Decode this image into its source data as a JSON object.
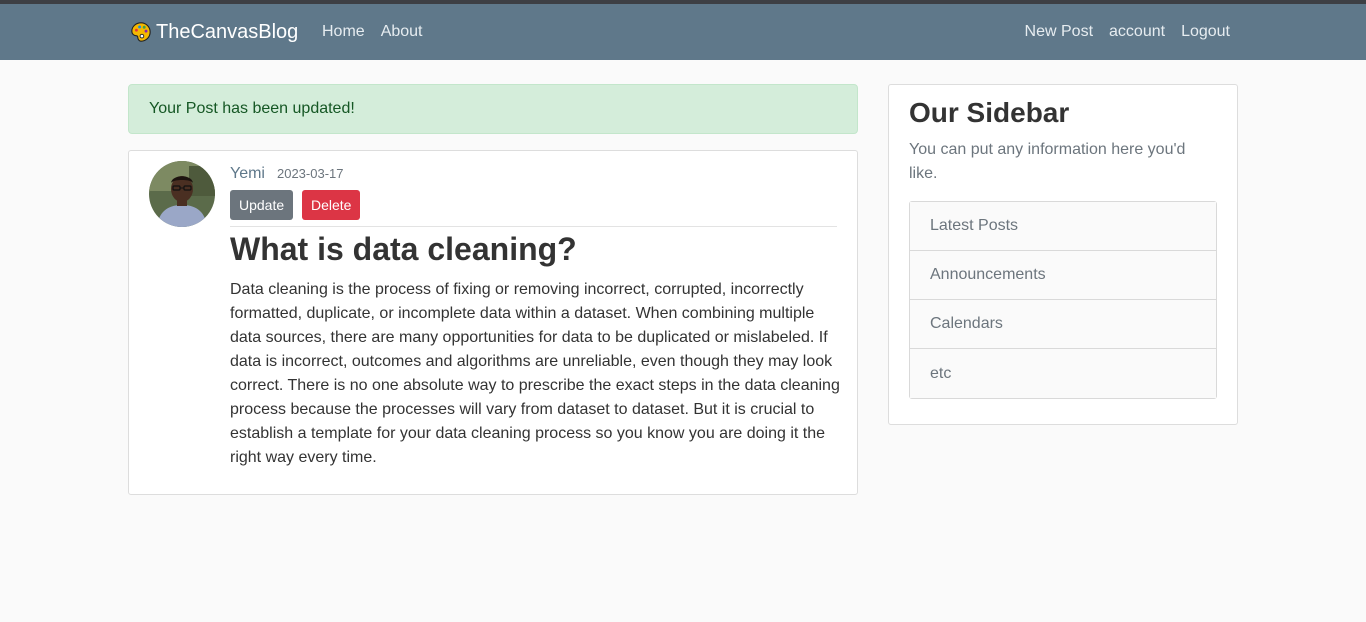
{
  "navbar": {
    "brand": "TheCanvasBlog",
    "left_links": [
      "Home",
      "About"
    ],
    "right_links": [
      "New Post",
      "account",
      "Logout"
    ]
  },
  "alert": {
    "message": "Your Post has been updated!"
  },
  "post": {
    "author": "Yemi",
    "date": "2023-03-17",
    "update_label": "Update",
    "delete_label": "Delete",
    "title": "What is data cleaning?",
    "content": "Data cleaning is the process of fixing or removing incorrect, corrupted, incorrectly formatted, duplicate, or incomplete data within a dataset. When combining multiple data sources, there are many opportunities for data to be duplicated or mislabeled. If data is incorrect, outcomes and algorithms are unreliable, even though they may look correct. There is no one absolute way to prescribe the exact steps in the data cleaning process because the processes will vary from dataset to dataset. But it is crucial to establish a template for your data cleaning process so you know you are doing it the right way every time."
  },
  "sidebar": {
    "title": "Our Sidebar",
    "description": "You can put any information here you'd like.",
    "items": [
      "Latest Posts",
      "Announcements",
      "Calendars",
      "etc"
    ]
  },
  "colors": {
    "navbar": "#5f788a",
    "alert_bg": "#d4edda",
    "update_button": "#6c757d",
    "delete_button": "#dc3545"
  },
  "icons": {
    "brand_logo": "palette-icon",
    "avatar": "user-avatar"
  }
}
